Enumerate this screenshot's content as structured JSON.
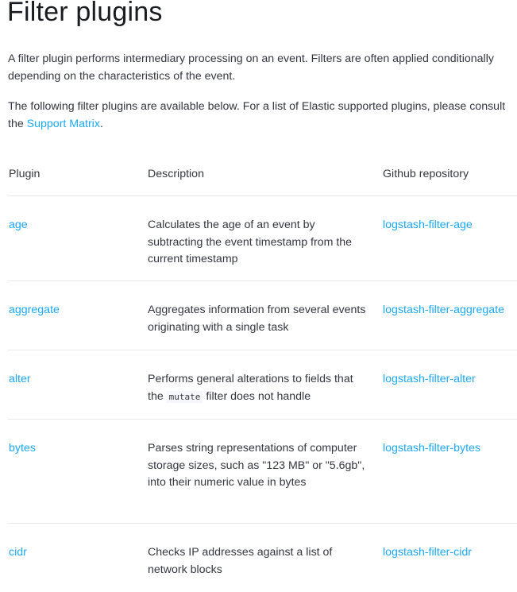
{
  "page": {
    "title": "Filter plugins",
    "intro1": "A filter plugin performs intermediary processing on an event. Filters are often applied conditionally depending on the characteristics of the event.",
    "intro2_before": "The following filter plugins are available below. For a list of Elastic supported plugins, please consult the ",
    "intro2_link": "Support Matrix",
    "intro2_after": "."
  },
  "colors": {
    "link": "#1ba9f5",
    "text": "#343741",
    "divider": "#e6e8ec"
  },
  "table": {
    "headers": [
      "Plugin",
      "Description",
      "Github repository"
    ],
    "rows": [
      {
        "plugin": "age",
        "description": "Calculates the age of an event by subtracting the event timestamp from the current timestamp",
        "repo": "logstash-filter-age"
      },
      {
        "plugin": "aggregate",
        "description": "Aggregates information from several events originating with a single task",
        "repo": "logstash-filter-aggregate"
      },
      {
        "plugin": "alter",
        "description_before": "Performs general alterations to fields that the ",
        "description_code": "mutate",
        "description_after": " filter does not handle",
        "repo": "logstash-filter-alter"
      },
      {
        "plugin": "bytes",
        "description": "Parses string representations of computer storage sizes, such as \"123 MB\" or \"5.6gb\", into their numeric value in bytes",
        "repo": "logstash-filter-bytes"
      },
      {
        "plugin": "cidr",
        "description": "Checks IP addresses against a list of network blocks",
        "repo": "logstash-filter-cidr"
      }
    ]
  }
}
